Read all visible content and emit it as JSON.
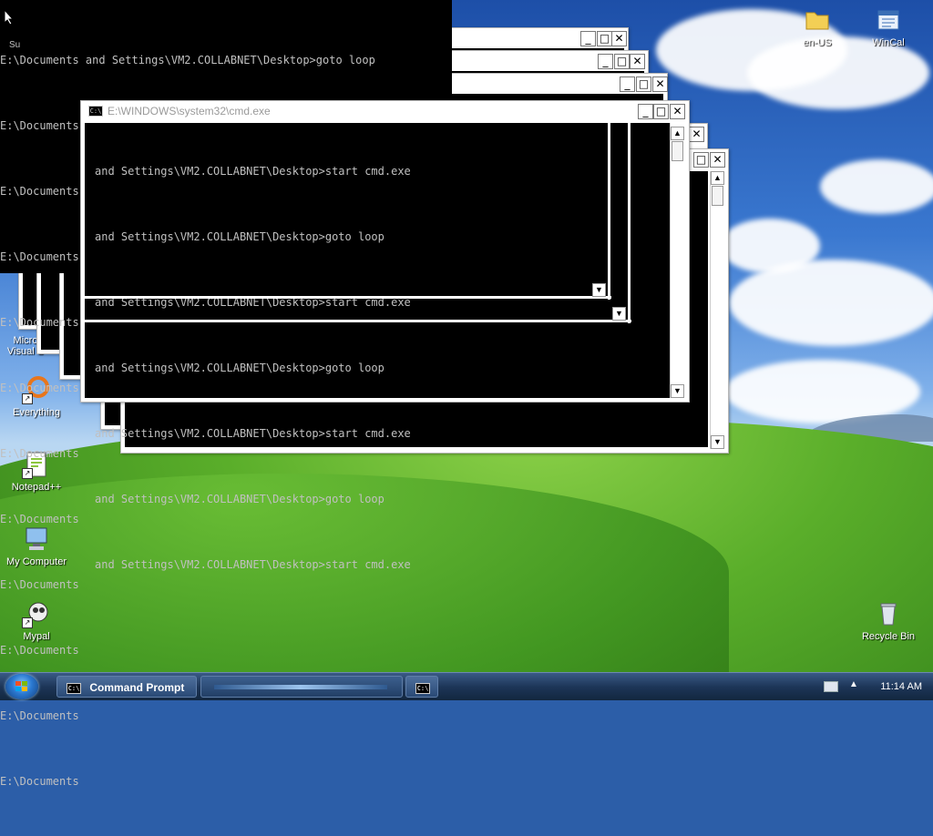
{
  "desktop": {
    "icons": [
      {
        "label": "en-US",
        "icon": "folder-icon"
      },
      {
        "label": "WinCal",
        "icon": "calendar-icon"
      },
      {
        "label": "Micro Visual S",
        "icon": "visual-studio-icon"
      },
      {
        "label": "Everything",
        "icon": "search-everything-icon"
      },
      {
        "label": "Notepad++",
        "icon": "notepad-plus-plus-icon"
      },
      {
        "label": "My Computer",
        "icon": "computer-icon"
      },
      {
        "label": "Mypal",
        "icon": "mypal-browser-icon"
      },
      {
        "label": "Recycle Bin",
        "icon": "recycle-bin-icon"
      }
    ],
    "partial_label": "Su"
  },
  "cmd": {
    "title": "E:\\WINDOWS\\system32\\cmd.exe",
    "minimize": "_",
    "maximize": "□",
    "close": "✕",
    "back_lines": [
      "E:\\Documents and Settings\\VM2.COLLABNET\\Desktop>goto loop",
      "E:\\Documents and Settings\\VM2.COLLABNET\\Desktop>start cmd.exe",
      "E:\\Documents and Settings\\VM2.COLLABNET\\Desktop>goto loop",
      "E:\\Documents and Settings\\VM2.COLLABNET\\Desktop>start cmd.exe",
      "E:\\Documents",
      "E:\\Documents",
      "E:\\Documents",
      "E:\\Documents",
      "E:\\Documents",
      "E:\\Documents",
      "E:\\Documents",
      "E:\\Documents"
    ],
    "front_lines": [
      "and Settings\\VM2.COLLABNET\\Desktop>start cmd.exe",
      "and Settings\\VM2.COLLABNET\\Desktop>goto loop",
      "and Settings\\VM2.COLLABNET\\Desktop>start cmd.exe",
      "and Settings\\VM2.COLLABNET\\Desktop>goto loop",
      "and Settings\\VM2.COLLABNET\\Desktop>start cmd.exe",
      "and Settings\\VM2.COLLABNET\\Desktop>goto loop",
      "and Settings\\VM2.COLLABNET\\Desktop>start cmd.exe"
    ]
  },
  "taskbar": {
    "task_label": "Command Prompt",
    "task_icon_text": "C:\\",
    "clock": "11:14 AM"
  }
}
